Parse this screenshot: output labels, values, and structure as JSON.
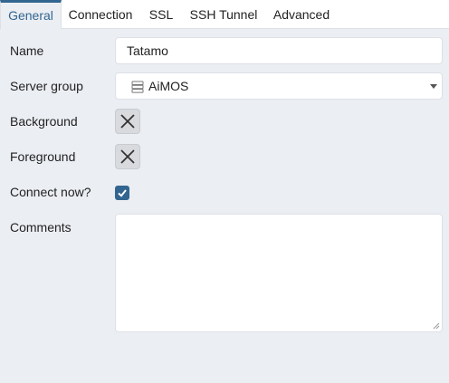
{
  "tabs": [
    {
      "label": "General",
      "active": true
    },
    {
      "label": "Connection",
      "active": false
    },
    {
      "label": "SSL",
      "active": false
    },
    {
      "label": "SSH Tunnel",
      "active": false
    },
    {
      "label": "Advanced",
      "active": false
    }
  ],
  "form": {
    "name": {
      "label": "Name",
      "value": "Tatamo"
    },
    "server_group": {
      "label": "Server group",
      "value": "AiMOS",
      "icon": "server-group-icon"
    },
    "background": {
      "label": "Background",
      "icon": "x-icon"
    },
    "foreground": {
      "label": "Foreground",
      "icon": "x-icon"
    },
    "connect_now": {
      "label": "Connect now?",
      "checked": true
    },
    "comments": {
      "label": "Comments",
      "value": ""
    }
  },
  "colors": {
    "accent": "#326690",
    "background": "#ebeef3",
    "input_border": "#dde0e6"
  }
}
